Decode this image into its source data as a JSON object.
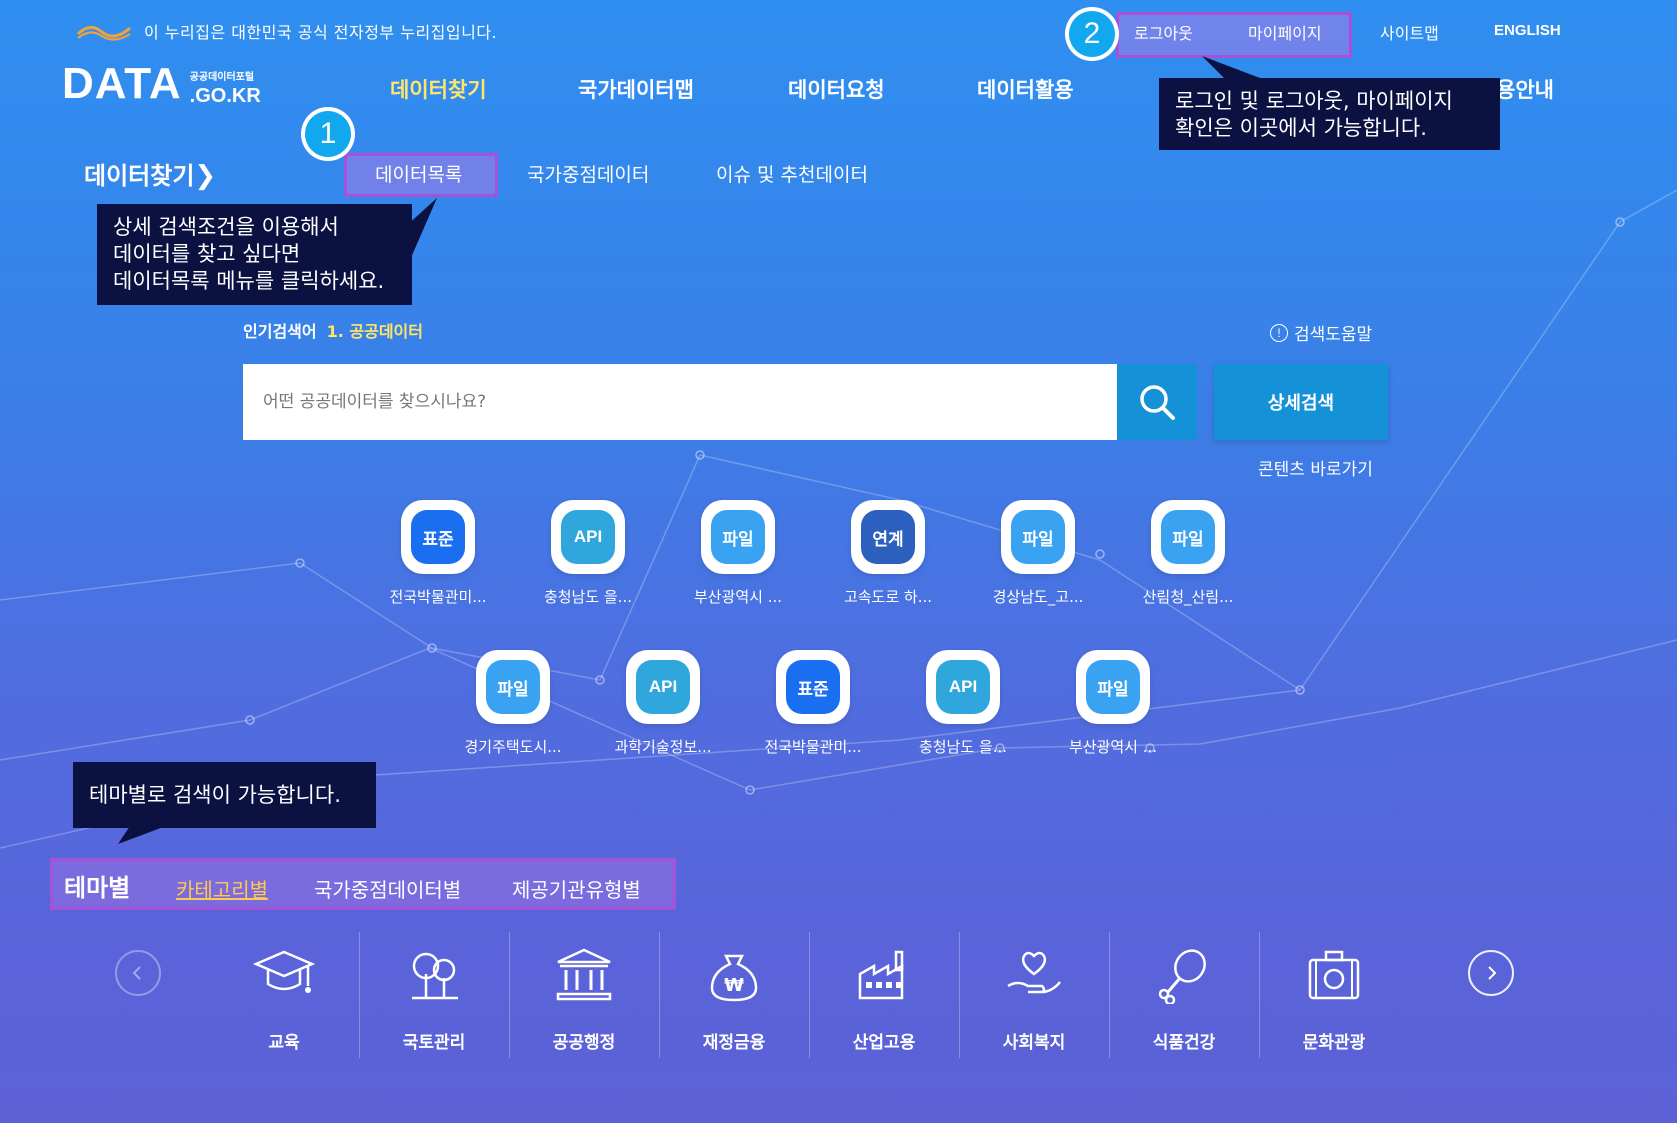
{
  "header": {
    "gov_notice": "이 누리집은 대한민국 공식 전자정부 누리집입니다.",
    "logo_main": "DATA",
    "logo_sub": "공공데이터포털",
    "logo_domain": ".GO.KR",
    "util": {
      "logout": "로그아웃",
      "mypage": "마이페이지",
      "sitemap": "사이트맵",
      "english": "ENGLISH"
    },
    "gnb": [
      "데이터찾기",
      "국가데이터맵",
      "데이터요청",
      "데이터활용",
      "용안내"
    ]
  },
  "subnav": {
    "section_title": "데이터찾기",
    "items": [
      "데이터목록",
      "국가중점데이터",
      "이슈 및 추천데이터"
    ]
  },
  "annotations": {
    "badge1": "1",
    "badge2": "2",
    "tip1": [
      "상세 검색조건을 이용해서",
      "데이터를 찾고 싶다면",
      "데이터목록 메뉴를 클릭하세요."
    ],
    "tip2": [
      "로그인  및  로그아웃, 마이페이지",
      "확인은 이곳에서 가능합니다."
    ],
    "tip3": "테마별로 검색이 가능합니다."
  },
  "search": {
    "popular_label": "인기검색어",
    "popular_keyword": "1. 공공데이터",
    "help": "검색도움말",
    "placeholder": "어떤 공공데이터를 찾으시나요?",
    "detail_button": "상세검색",
    "content_shortcut": "콘텐츠 바로가기"
  },
  "tiles": [
    {
      "type": "std",
      "badge": "표준",
      "label": "전국박물관미..."
    },
    {
      "type": "api",
      "badge": "API",
      "label": "충청남도 을..."
    },
    {
      "type": "file",
      "badge": "파일",
      "label": "부산광역시 ..."
    },
    {
      "type": "link",
      "badge": "연계",
      "label": "고속도로 하..."
    },
    {
      "type": "file",
      "badge": "파일",
      "label": "경상남도_고..."
    },
    {
      "type": "file",
      "badge": "파일",
      "label": "산림청_산림..."
    },
    {
      "type": "file",
      "badge": "파일",
      "label": "경기주택도시..."
    },
    {
      "type": "api",
      "badge": "API",
      "label": "과학기술정보..."
    },
    {
      "type": "std",
      "badge": "표준",
      "label": "전국박물관미..."
    },
    {
      "type": "api",
      "badge": "API",
      "label": "충청남도 을..."
    },
    {
      "type": "file",
      "badge": "파일",
      "label": "부산광역시 ..."
    }
  ],
  "theme": {
    "title": "테마별",
    "tabs": [
      "카테고리별",
      "국가중점데이터별",
      "제공기관유형별"
    ],
    "active_color": "#ffc94d"
  },
  "categories": [
    {
      "icon": "graduation-cap-icon",
      "label": "교육"
    },
    {
      "icon": "trees-icon",
      "label": "국토관리"
    },
    {
      "icon": "government-building-icon",
      "label": "공공행정"
    },
    {
      "icon": "money-bag-icon",
      "label": "재정금융"
    },
    {
      "icon": "factory-icon",
      "label": "산업고용"
    },
    {
      "icon": "heart-hand-icon",
      "label": "사회복지"
    },
    {
      "icon": "chicken-leg-icon",
      "label": "식품건강"
    },
    {
      "icon": "camera-suitcase-icon",
      "label": "문화관광"
    }
  ],
  "colors": {
    "highlight_box": "#a652d8",
    "tooltip_bg": "#0b1140",
    "badge": "#12a8f0",
    "active_menu": "#ffe66b",
    "button": "#1591d8"
  }
}
